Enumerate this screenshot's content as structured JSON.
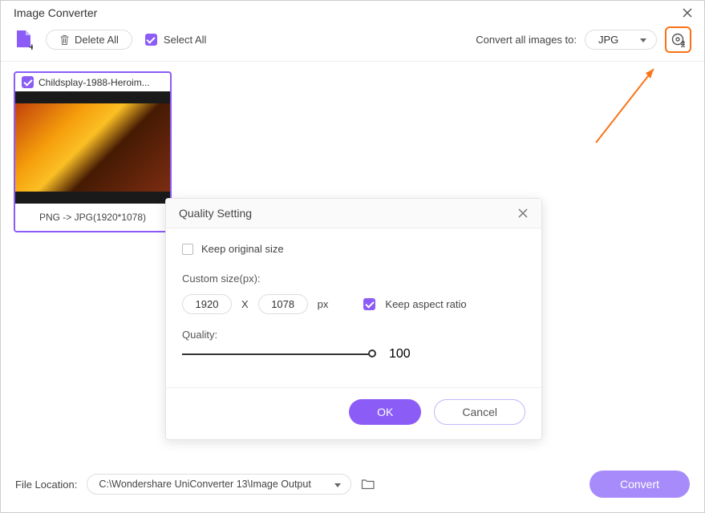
{
  "window": {
    "title": "Image Converter"
  },
  "toolbar": {
    "delete_all": "Delete All",
    "select_all": "Select All",
    "convert_all_label": "Convert all images to:",
    "selected_format": "JPG"
  },
  "thumbnail": {
    "filename": "Childsplay-1988-Heroim...",
    "caption": "PNG -> JPG(1920*1078)"
  },
  "modal": {
    "title": "Quality Setting",
    "keep_original": "Keep original size",
    "custom_size_label": "Custom size(px):",
    "width": "1920",
    "x": "X",
    "height": "1078",
    "px": "px",
    "keep_aspect": "Keep aspect ratio",
    "quality_label": "Quality:",
    "quality_value": "100",
    "ok": "OK",
    "cancel": "Cancel"
  },
  "footer": {
    "label": "File Location:",
    "path": "C:\\Wondershare UniConverter 13\\Image Output",
    "convert": "Convert"
  }
}
